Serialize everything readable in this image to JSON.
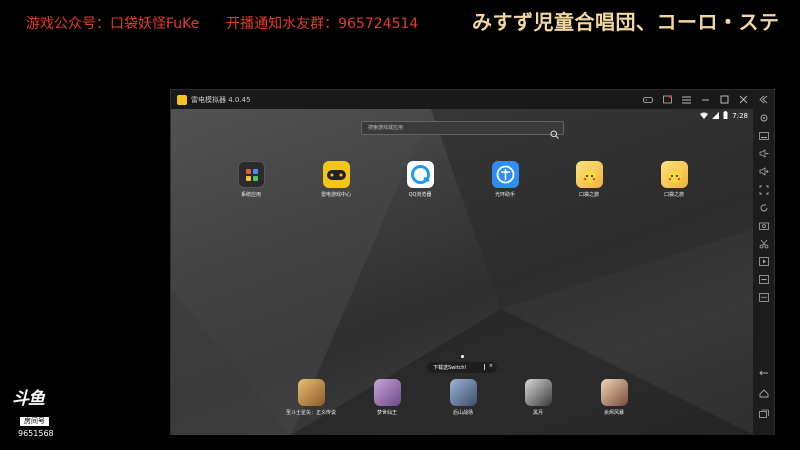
{
  "overlay": {
    "left_text_1": "游戏公众号：口袋妖怪FuKe",
    "left_text_2": "开播通知水友群：",
    "left_number": "965724514",
    "right_text": "みすず児童合唱団、コーロ・ステ",
    "colors": {
      "left": "#e13c28",
      "right": "#f1d7a0"
    }
  },
  "douyu": {
    "logo": "斗鱼",
    "room_label": "房间号",
    "room_id": "9651568"
  },
  "emulator": {
    "title": "雷电模拟器 4.0.45",
    "status": {
      "time": "7:28"
    },
    "search": {
      "placeholder": "搜索游戏或应用"
    },
    "apps_top": [
      {
        "label": "系统应用",
        "icon": "system-apps-icon"
      },
      {
        "label": "雷电游戏中心",
        "icon": "game-center-icon"
      },
      {
        "label": "QQ浏览器",
        "icon": "qq-browser-icon"
      },
      {
        "label": "光环助手",
        "icon": "guanghuan-icon"
      },
      {
        "label": "口袋之旅",
        "icon": "pokemon-icon"
      },
      {
        "label": "口袋之旅",
        "icon": "pokemon-icon"
      }
    ],
    "switch_banner": {
      "text": "下载送Switch!",
      "separator": "|",
      "close": "×"
    },
    "apps_bottom": [
      {
        "label": "圣斗士星矢：正义传说",
        "icon": "saint-seiya-icon"
      },
      {
        "label": "梦世仙王",
        "icon": "game-icon"
      },
      {
        "label": "后山战场",
        "icon": "game-icon"
      },
      {
        "label": "黑月",
        "icon": "game-icon"
      },
      {
        "label": "余烬风暴",
        "icon": "game-icon"
      }
    ]
  }
}
